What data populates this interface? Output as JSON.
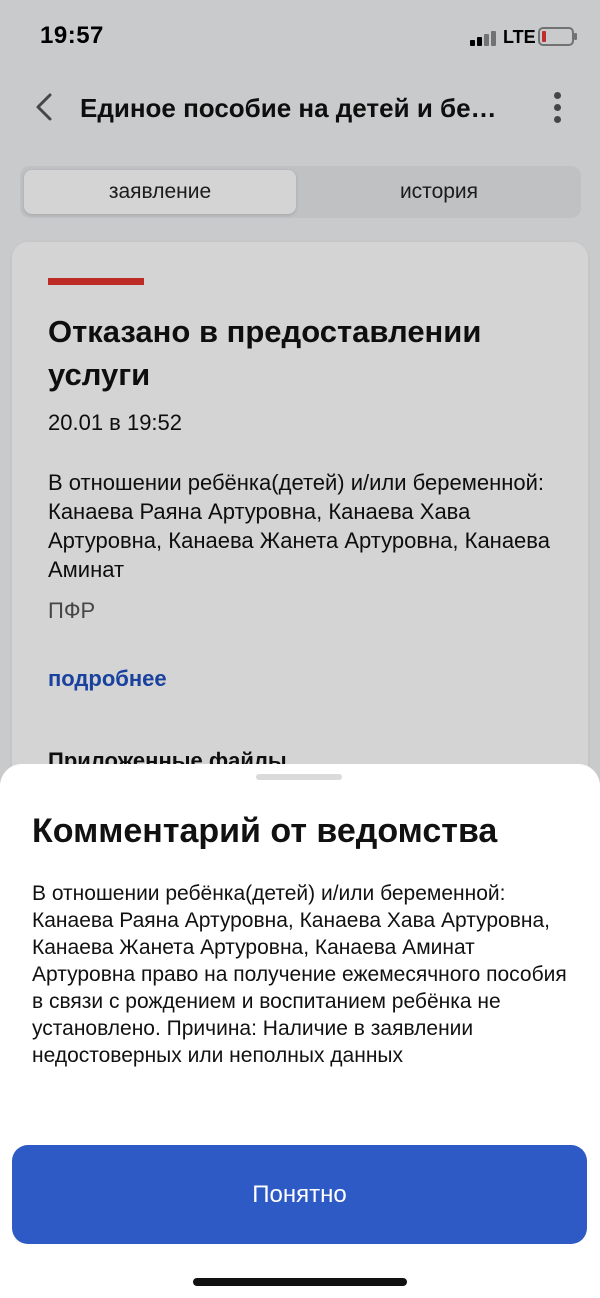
{
  "status_bar": {
    "time": "19:57",
    "network": "LTE",
    "icons": [
      "signal-icon",
      "battery-icon"
    ]
  },
  "header": {
    "title": "Единое пособие на детей и беременных",
    "back_icon": "chevron-left-icon",
    "menu_icon": "more-vertical-icon"
  },
  "tabs": [
    {
      "label": "заявление",
      "active": true
    },
    {
      "label": "история",
      "active": false
    }
  ],
  "application": {
    "status": "Отказано в предоставлении услуги",
    "status_color": "#e2342c",
    "date": "20.01 в 19:52",
    "description": "В отношении ребёнка(детей) и/или беременной: Канаева Раяна Артуровна, Канаева Хава Артуровна, Канаева Жанета Артуровна, Канаева Аминат",
    "agency": "ПФР",
    "details_link": "подробнее",
    "files_heading": "Приложенные файлы"
  },
  "sheet": {
    "title": "Комментарий от ведомства",
    "text": "В отношении ребёнка(детей) и/или беременной: Канаева Раяна Артуровна, Канаева Хава Артуровна, Канаева Жанета Артуровна, Канаева Аминат Артуровна право на получение ежемесячного пособия в связи с рождением и воспитанием ребёнка не установлено. Причина: Наличие в заявлении недостоверных или неполных данных",
    "button_label": "Понятно"
  },
  "colors": {
    "accent": "#2d5ac4",
    "link": "#1f4fbf",
    "error": "#e2342c"
  }
}
